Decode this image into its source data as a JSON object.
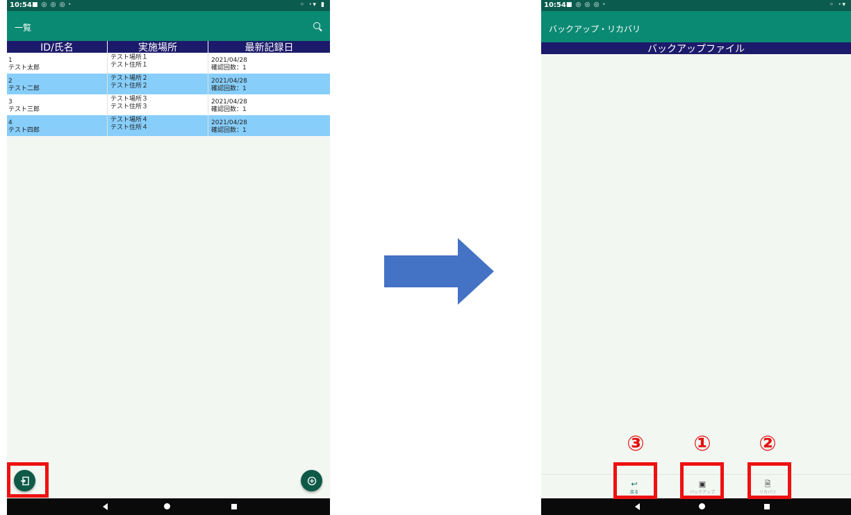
{
  "left_screen": {
    "status_time": "10:54",
    "status_icons": "■ ◎ ◎ ◎ ·",
    "status_right": "◦ ·▾ ▮",
    "app_title": "一覧",
    "columns": [
      "ID/氏名",
      "実施場所",
      "最新記録日"
    ],
    "rows": [
      {
        "id": "1",
        "name": "テスト太郎",
        "place": "テスト場所１",
        "address": "テスト住所１",
        "date": "2021/04/28",
        "count": "確認回数：1"
      },
      {
        "id": "2",
        "name": "テスト二郎",
        "place": "テスト場所２",
        "address": "テスト住所２",
        "date": "2021/04/28",
        "count": "確認回数：1"
      },
      {
        "id": "3",
        "name": "テスト三郎",
        "place": "テスト場所３",
        "address": "テスト住所３",
        "date": "2021/04/28",
        "count": "確認回数：1"
      },
      {
        "id": "4",
        "name": "テスト四郎",
        "place": "テスト場所４",
        "address": "テスト住所４",
        "date": "2021/04/28",
        "count": "確認回数：1"
      }
    ],
    "fab_export_icon": "export-icon",
    "fab_add_icon": "add-circle-icon"
  },
  "right_screen": {
    "status_time": "10:54",
    "status_icons": "■ ◎ ◎ ◎ ·",
    "status_right": "◦ ·▾",
    "app_title": "バックアップ・リカバリ",
    "list_header": "バックアップファイル",
    "buttons": [
      {
        "label": "戻る",
        "icon": "↩",
        "number": "③"
      },
      {
        "label": "バックアップ",
        "icon": "▣",
        "number": "①"
      },
      {
        "label": "リカバリ",
        "icon": "🗎",
        "number": "②"
      }
    ]
  },
  "colors": {
    "status_bar": "#0b5c4e",
    "app_bar": "#0b8a73",
    "table_header": "#1c1a6a",
    "row_highlight": "#87cefa",
    "annotation_red": "#ee1111",
    "arrow": "#4472c4"
  }
}
